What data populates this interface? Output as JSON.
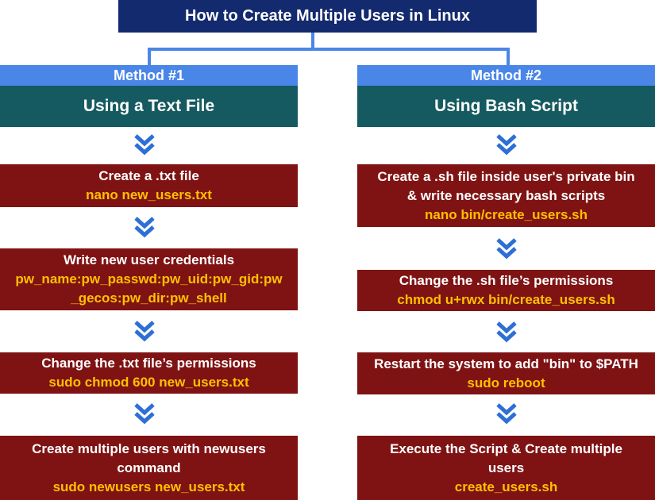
{
  "title": "How to Create Multiple Users in Linux",
  "colors": {
    "title_bg": "#142a6e",
    "connector": "#4a86e8",
    "method_bar": "#4a86e8",
    "method_sub": "#155a60",
    "step_bg": "#7f1313",
    "step_text": "#ffffff",
    "command_text": "#ffc000",
    "chevron_fill": "#2e6fd6"
  },
  "methods": [
    {
      "label": "Method #1",
      "subtitle": "Using a Text File",
      "steps": [
        {
          "lines": [
            "Create a .txt file"
          ],
          "command": "nano new_users.txt"
        },
        {
          "lines": [
            "Write new user credentials"
          ],
          "command_lines": [
            "pw_name:pw_passwd:pw_uid:pw_gid:pw",
            "_gecos:pw_dir:pw_shell"
          ]
        },
        {
          "lines": [
            "Change the .txt file’s permissions"
          ],
          "command": "sudo chmod 600 new_users.txt"
        },
        {
          "lines": [
            "Create multiple users with newusers",
            "command"
          ],
          "command": "sudo newusers new_users.txt"
        }
      ]
    },
    {
      "label": "Method #2",
      "subtitle": "Using Bash Script",
      "steps": [
        {
          "lines": [
            "Create a .sh file inside user's private bin",
            "& write necessary bash scripts"
          ],
          "command": "nano bin/create_users.sh"
        },
        {
          "lines": [
            "Change the .sh file’s permissions"
          ],
          "command": "chmod u+rwx bin/create_users.sh"
        },
        {
          "lines": [
            "Restart the system to add \"bin\" to $PATH"
          ],
          "command": "sudo reboot"
        },
        {
          "lines": [
            "Execute the Script & Create multiple",
            "users"
          ],
          "command": "create_users.sh"
        }
      ]
    }
  ]
}
